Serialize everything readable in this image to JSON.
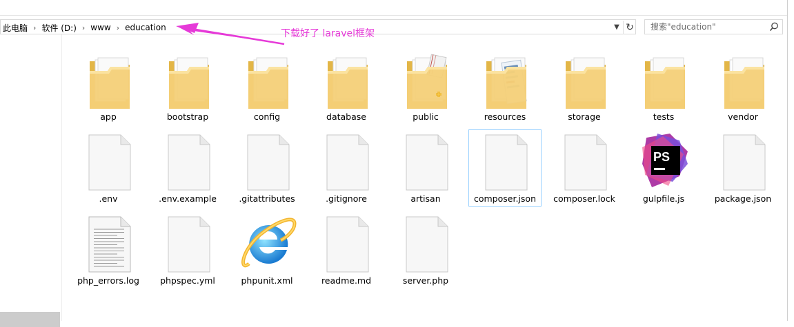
{
  "breadcrumb": [
    "此电脑",
    "软件 (D:)",
    "www",
    "education"
  ],
  "search": {
    "placeholder": "搜索\"education\""
  },
  "annotation": {
    "text": "下载好了 laravel框架",
    "color": "#e63ad8"
  },
  "files": [
    {
      "name": "app",
      "type": "folder"
    },
    {
      "name": "bootstrap",
      "type": "folder"
    },
    {
      "name": "config",
      "type": "folder"
    },
    {
      "name": "database",
      "type": "folder"
    },
    {
      "name": "public",
      "type": "folder-public"
    },
    {
      "name": "resources",
      "type": "folder-resources"
    },
    {
      "name": "storage",
      "type": "folder"
    },
    {
      "name": "tests",
      "type": "folder"
    },
    {
      "name": "vendor",
      "type": "folder"
    },
    {
      "name": ".env",
      "type": "file"
    },
    {
      "name": ".env.example",
      "type": "file"
    },
    {
      "name": ".gitattributes",
      "type": "file"
    },
    {
      "name": ".gitignore",
      "type": "file"
    },
    {
      "name": "artisan",
      "type": "file"
    },
    {
      "name": "composer.json",
      "type": "file",
      "selected": true
    },
    {
      "name": "composer.lock",
      "type": "file"
    },
    {
      "name": "gulpfile.js",
      "type": "phpstorm"
    },
    {
      "name": "package.json",
      "type": "file"
    },
    {
      "name": "php_errors.log",
      "type": "textfile"
    },
    {
      "name": "phpspec.yml",
      "type": "file"
    },
    {
      "name": "phpunit.xml",
      "type": "ie"
    },
    {
      "name": "readme.md",
      "type": "file"
    },
    {
      "name": "server.php",
      "type": "file"
    }
  ]
}
